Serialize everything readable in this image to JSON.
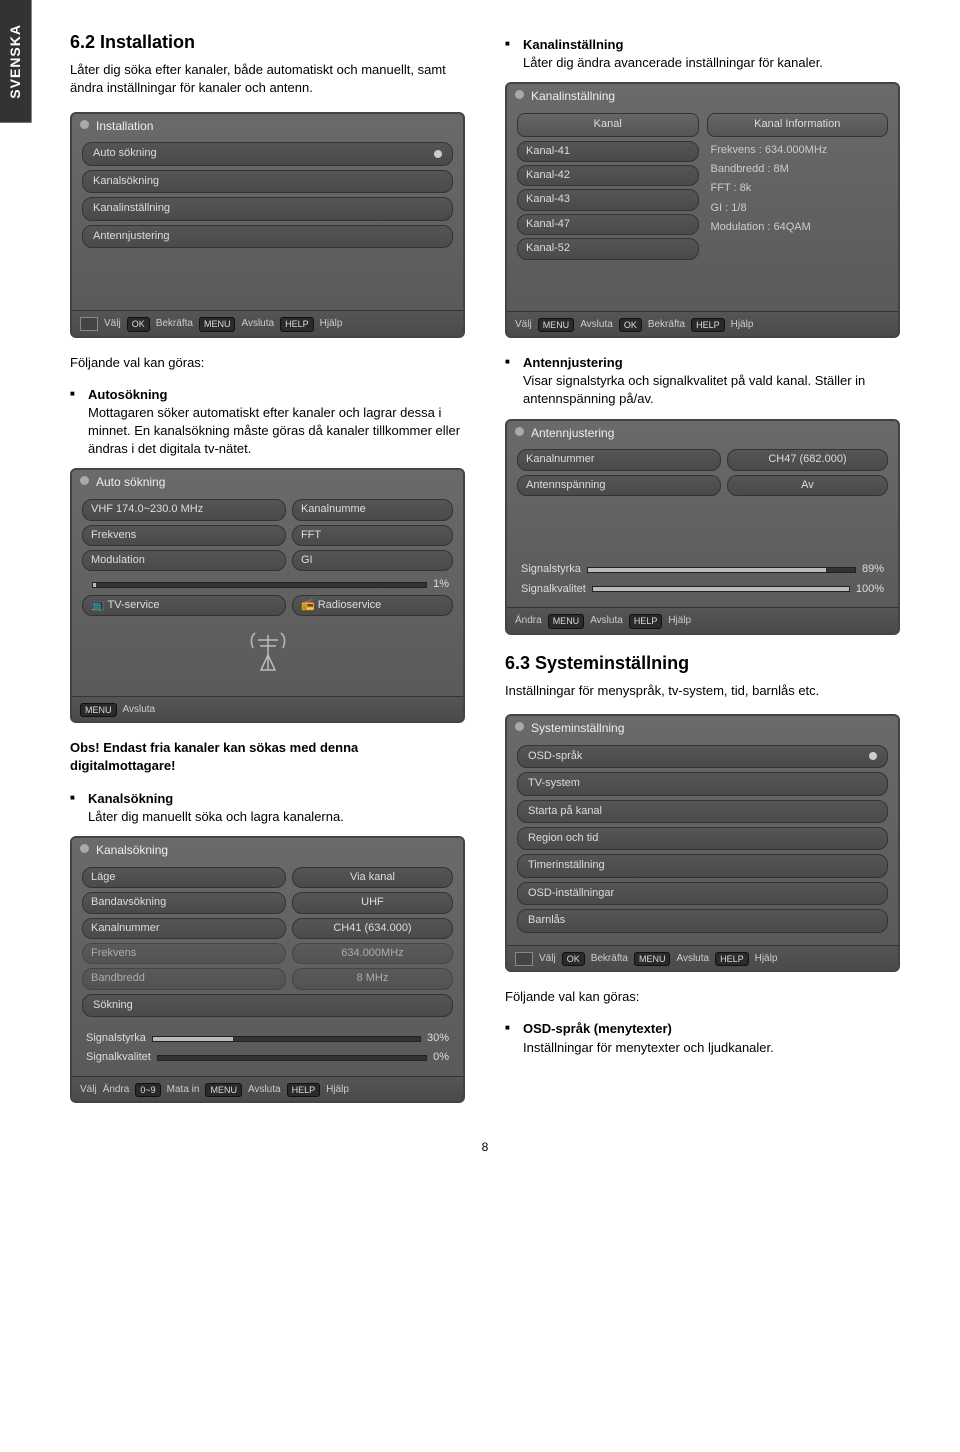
{
  "side_tab": "SVENSKA",
  "page_number": "8",
  "left": {
    "h1": "6.2 Installation",
    "intro": "Låter dig söka efter kanaler, både automatiskt och manuellt, samt ändra inställningar för kanaler och antenn.",
    "shot1": {
      "title": "Installation",
      "items": [
        "Auto sökning",
        "Kanalsökning",
        "Kanalinställning",
        "Antennjustering"
      ],
      "footer": [
        "Välj",
        "OK",
        "Bekräfta",
        "MENU",
        "Avsluta",
        "HELP",
        "Hjälp"
      ]
    },
    "following": "Följande val kan göras:",
    "auto_title": "Autosökning",
    "auto_body": "Mottagaren söker automatiskt efter kanaler och lagrar dessa i minnet. En kanalsökning måste göras då kanaler tillkommer eller ändras i det digitala tv-nätet.",
    "shot2": {
      "title": "Auto sökning",
      "row1a": "VHF   174.0~230.0 MHz",
      "row1b": "Kanalnumme",
      "row2a": "Frekvens",
      "row2b": "FFT",
      "row3a": "Modulation",
      "row3b": "GI",
      "pct": "1%",
      "svc1": "TV-service",
      "svc2": "Radioservice",
      "footer": [
        "MENU",
        "Avsluta"
      ]
    },
    "obs": "Obs! Endast fria kanaler kan sökas med denna digitalmottagare!",
    "kanal_title": "Kanalsökning",
    "kanal_body": "Låter dig manuellt söka och lagra kanalerna.",
    "shot3": {
      "title": "Kanalsökning",
      "r1a": "Läge",
      "r1b": "Via kanal",
      "r2a": "Bandavsökning",
      "r2b": "UHF",
      "r3a": "Kanalnummer",
      "r3b": "CH41 (634.000)",
      "r4a": "Frekvens",
      "r4b": "634.000MHz",
      "r5a": "Bandbredd",
      "r5b": "8 MHz",
      "r6": "Sökning",
      "sig1": "Signalstyrka",
      "sig1v": "30%",
      "sig2": "Signalkvalitet",
      "sig2v": "0%",
      "footer": [
        "Välj",
        "Ändra",
        "0~9",
        "Mata in",
        "MENU",
        "Avsluta",
        "HELP",
        "Hjälp"
      ]
    }
  },
  "right": {
    "kinst_title": "Kanalinställning",
    "kinst_body": "Låter dig ändra avancerade inställningar för kanaler.",
    "shot4": {
      "title": "Kanalinställning",
      "col1": "Kanal",
      "col2": "Kanal Information",
      "channels": [
        "Kanal-41",
        "Kanal-42",
        "Kanal-43",
        "Kanal-47",
        "Kanal-52"
      ],
      "info": [
        "Frekvens : 634.000MHz",
        "Bandbredd : 8M",
        "FFT : 8k",
        "GI : 1/8",
        "Modulation : 64QAM"
      ],
      "footer": [
        "Välj",
        "MENU",
        "Avsluta",
        "OK",
        "Bekräfta",
        "HELP",
        "Hjälp"
      ]
    },
    "ant_title": "Antennjustering",
    "ant_body": "Visar signalstyrka och signalkvalitet på vald kanal. Ställer in antennspänning på/av.",
    "shot5": {
      "title": "Antennjustering",
      "r1a": "Kanalnummer",
      "r1b": "CH47 (682.000)",
      "r2a": "Antennspänning",
      "r2b": "Av",
      "sig1": "Signalstyrka",
      "sig1v": "89%",
      "sig2": "Signalkvalitet",
      "sig2v": "100%",
      "footer": [
        "Ändra",
        "MENU",
        "Avsluta",
        "HELP",
        "Hjälp"
      ]
    },
    "h2": "6.3 Systeminställning",
    "h2_body": "Inställningar för menyspråk, tv-system, tid, barnlås etc.",
    "shot6": {
      "title": "Systeminställning",
      "items": [
        "OSD-språk",
        "TV-system",
        "Starta på kanal",
        "Region och tid",
        "Timerinställning",
        "OSD-inställningar",
        "Barnlås"
      ],
      "footer": [
        "Välj",
        "OK",
        "Bekräfta",
        "MENU",
        "Avsluta",
        "HELP",
        "Hjälp"
      ]
    },
    "following": "Följande val kan göras:",
    "osd_title": "OSD-språk (menytexter)",
    "osd_body": "Inställningar för menytexter och ljudkanaler."
  }
}
